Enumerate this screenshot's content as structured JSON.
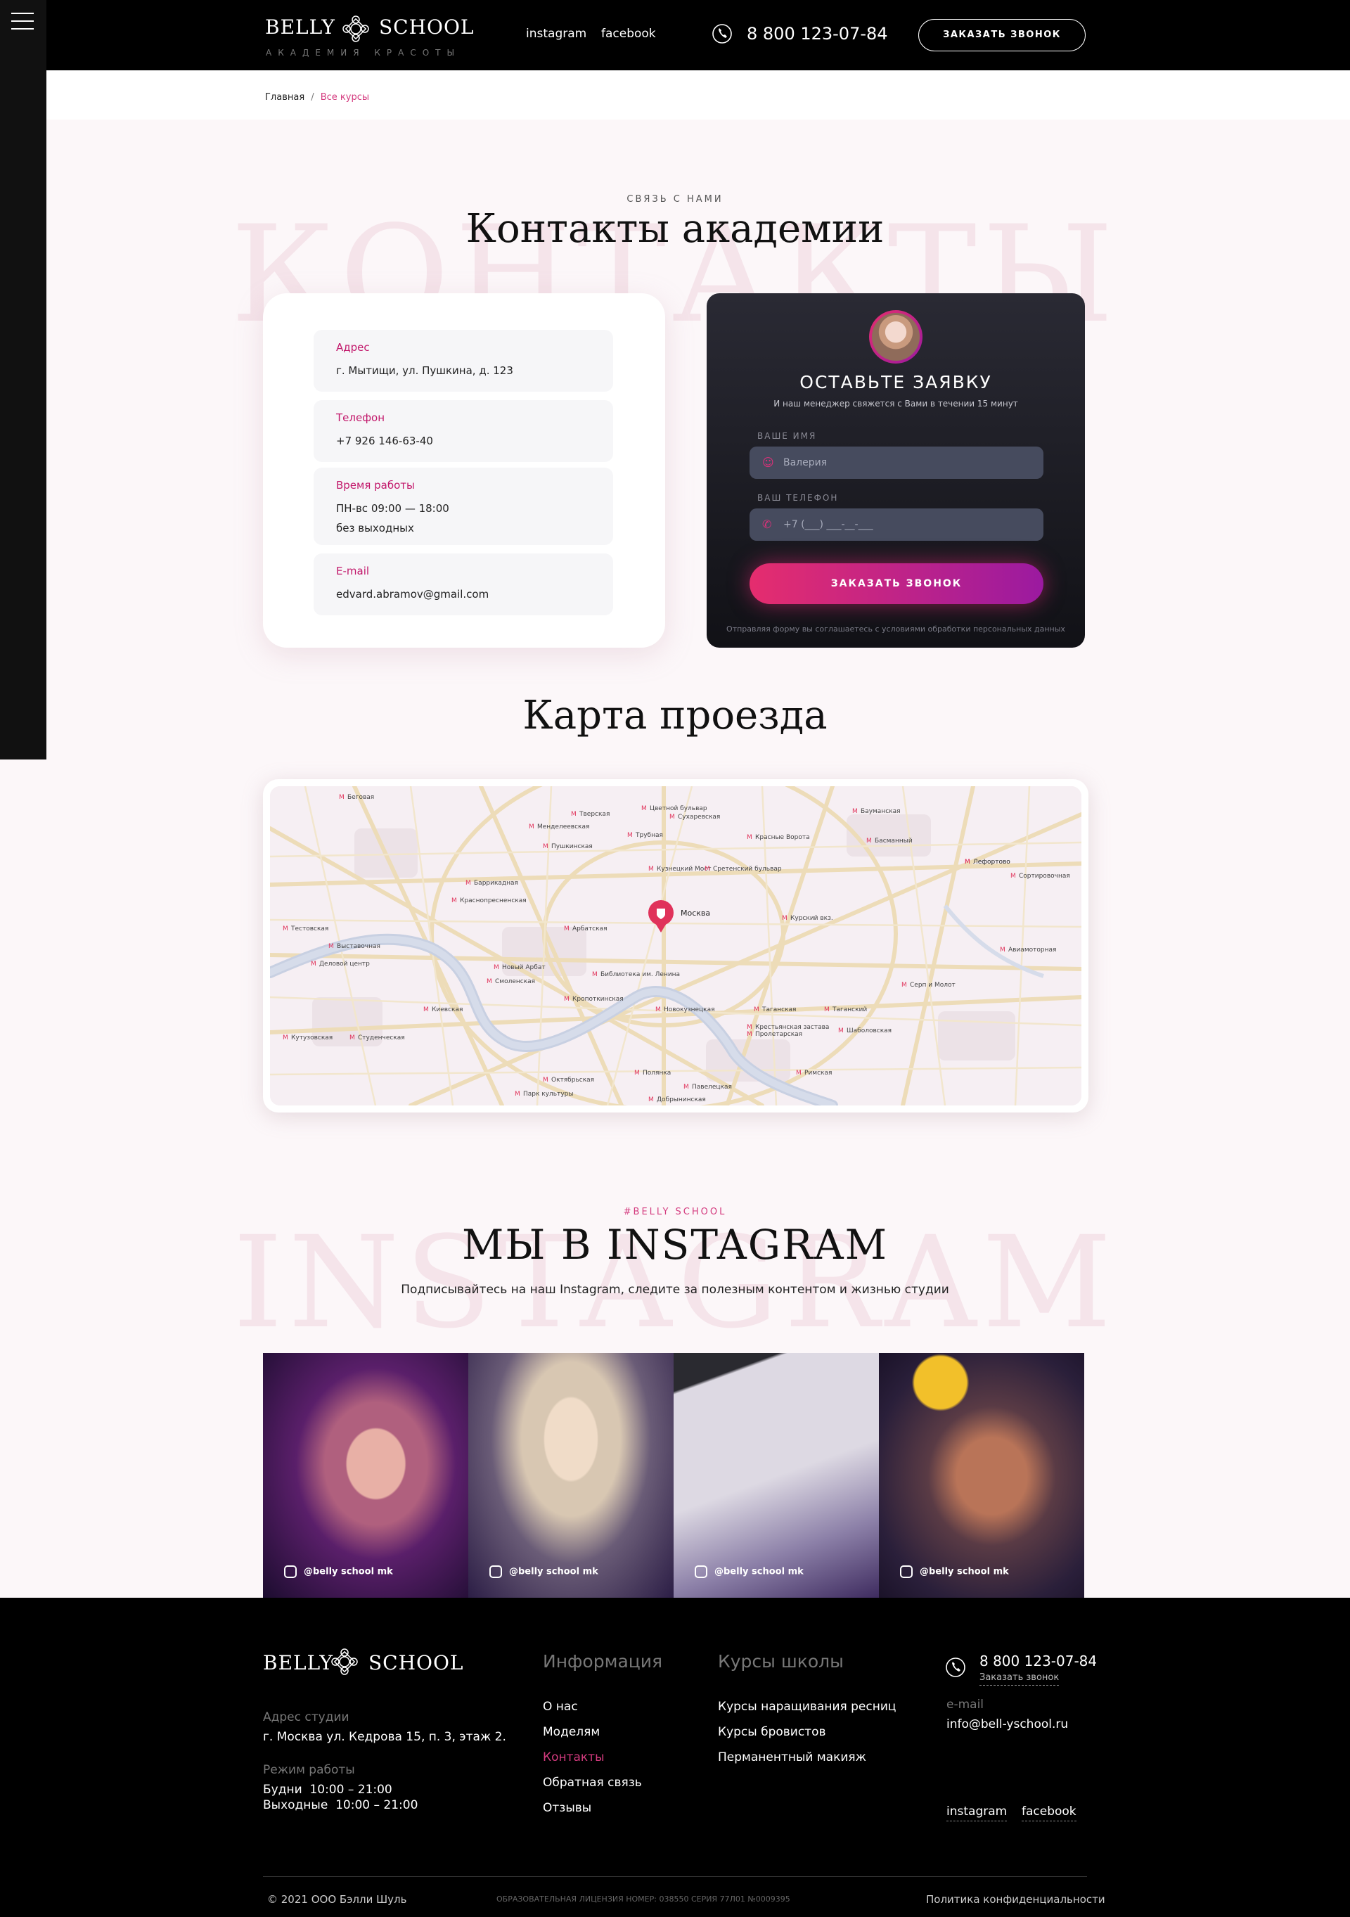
{
  "header": {
    "logo_left": "BELLY",
    "logo_right": "SCHOOL",
    "logo_sub": "АКАДЕМИЯ КРАСОТЫ",
    "nav": [
      "instagram",
      "facebook"
    ],
    "phone": "8 800 123-07-84",
    "cta": "ЗАКАЗАТЬ ЗВОНОК"
  },
  "breadcrumb": {
    "home": "Главная",
    "separator": "/",
    "current": "Все курсы"
  },
  "contacts": {
    "ghost": "КОНТАКТЫ",
    "eyebrow": "СВЯЗЬ С НАМИ",
    "title": "Контакты академии",
    "address": {
      "label": "Адрес",
      "value": "г. Мытищи, ул. Пушкина, д. 123"
    },
    "phone": {
      "label": "Телефон",
      "value": "+7 926 146-63-40"
    },
    "hours": {
      "label": "Время работы",
      "value1": "ПН-вс 09:00 — 18:00",
      "value2": "без выходных"
    },
    "email": {
      "label": "E-mail",
      "value": "edvard.abramov@gmail.com"
    }
  },
  "form": {
    "title": "ОСТАВЬТЕ ЗАЯВКУ",
    "subtitle": "И наш менеджер свяжется с Вами в течении 15 минут",
    "name_label": "ВАШЕ ИМЯ",
    "name_placeholder": "Валерия",
    "phone_label": "ВАШ ТЕЛЕФОН",
    "phone_placeholder": "+7 (___) ___-__-___",
    "submit": "ЗАКАЗАТЬ ЗВОНОК",
    "consent": "Отправляя форму вы соглашаетесь с условиями обработки персональных данных"
  },
  "map": {
    "title": "Карта проезда",
    "pin_label": "Москва",
    "labels": [
      "Беговая",
      "Менделеевская",
      "Тверская",
      "Цветной бульвар",
      "Сухаревская",
      "Бауманская",
      "Пушкинская",
      "Трубная",
      "Красные Ворота",
      "Баррикадная",
      "Кузнецкий Мост",
      "Сретенский бульвар",
      "Краснопресненская",
      "Арбатская",
      "Курский вкз.",
      "Выставочная",
      "Смоленская",
      "Библиотека им. Ленина",
      "Киевская",
      "Кропоткинская",
      "Новокузнецкая",
      "Таганская",
      "Тестовская",
      "Деловой центр",
      "Кутузовская",
      "Студенческая",
      "Полянка",
      "Парк культуры",
      "Октябрьская",
      "Добрынинская",
      "Павелецкая",
      "Римская",
      "Серп и Молот",
      "Авиамоторная",
      "Лефортово",
      "Сортировочная",
      "Крестьянская застава",
      "Пролетарская",
      "Шаболовская",
      "Новый Арбат",
      "Таганский",
      "Басманный",
      "Лефортово"
    ]
  },
  "instagram": {
    "ghost": "INSTAGRAM",
    "eyebrow": "#BELLY SCHOOL",
    "title": "МЫ В INSTAGRAM",
    "subtitle": "Подписывайтесь на наш Instagram, следите за полезным контентом и жизнью студии",
    "handles": [
      "@belly school mk",
      "@belly school mk",
      "@belly school mk",
      "@belly school mk"
    ]
  },
  "footer": {
    "logo_left": "BELLY",
    "logo_right": "SCHOOL",
    "address_label": "Адрес студии",
    "address": "г. Москва ул. Кедрова 15, п. 3, этаж 2.",
    "hours_label": "Режим работы",
    "hours_weekdays": "Будни  10:00 – 21:00",
    "hours_weekend": "Выходные  10:00 – 21:00",
    "info_title": "Информация",
    "info_links": [
      "О нас",
      "Моделям",
      "Контакты",
      "Обратная связь",
      "Отзывы"
    ],
    "courses_title": "Курсы школы",
    "courses_links": [
      "Курсы наращивания ресниц",
      "Курсы бровистов",
      "Перманентный макияж"
    ],
    "phone": "8 800 123-07-84",
    "callback": "Заказать звонок",
    "email_label": "e-mail",
    "email": "info@bell-yschool.ru",
    "social": [
      "instagram",
      "facebook"
    ],
    "copyright": "© 2021 ООО Бэлли Шуль",
    "license": "ОБРАЗОВАТЕЛЬНАЯ ЛИЦЕНЗИЯ НОМЕР: 038550 СЕРИЯ 77Л01 №0009395",
    "privacy": "Политика конфиденциальности"
  },
  "colors": {
    "accent": "#d43b7f",
    "dark": "#000000",
    "page_bg": "#fcf7f9"
  }
}
